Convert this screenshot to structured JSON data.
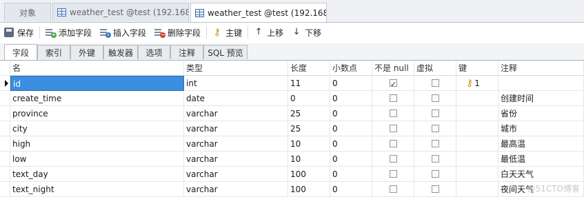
{
  "tabs": {
    "objects": "对象",
    "tab1": "weather_test @test (192.168...",
    "tab2": "weather_test @test (192.168..."
  },
  "toolbar": {
    "save": "保存",
    "add_field": "添加字段",
    "insert_field": "插入字段",
    "delete_field": "删除字段",
    "primary_key": "主键",
    "move_up": "上移",
    "move_down": "下移"
  },
  "subtabs": [
    "字段",
    "索引",
    "外键",
    "触发器",
    "选项",
    "注释",
    "SQL 预览"
  ],
  "columns": {
    "name": "名",
    "type": "类型",
    "length": "长度",
    "decimals": "小数点",
    "not_null": "不是 null",
    "virtual": "虚拟",
    "key": "键",
    "comment": "注释"
  },
  "rows": [
    {
      "name": "id",
      "type": "int",
      "length": "11",
      "decimals": "0",
      "not_null": true,
      "virtual": false,
      "key": "1",
      "comment": ""
    },
    {
      "name": "create_time",
      "type": "date",
      "length": "0",
      "decimals": "0",
      "not_null": false,
      "virtual": false,
      "key": "",
      "comment": "创建时间"
    },
    {
      "name": "province",
      "type": "varchar",
      "length": "25",
      "decimals": "0",
      "not_null": false,
      "virtual": false,
      "key": "",
      "comment": "省份"
    },
    {
      "name": "city",
      "type": "varchar",
      "length": "25",
      "decimals": "0",
      "not_null": false,
      "virtual": false,
      "key": "",
      "comment": "城市"
    },
    {
      "name": "high",
      "type": "varchar",
      "length": "10",
      "decimals": "0",
      "not_null": false,
      "virtual": false,
      "key": "",
      "comment": "最高温"
    },
    {
      "name": "low",
      "type": "varchar",
      "length": "10",
      "decimals": "0",
      "not_null": false,
      "virtual": false,
      "key": "",
      "comment": "最低温"
    },
    {
      "name": "text_day",
      "type": "varchar",
      "length": "100",
      "decimals": "0",
      "not_null": false,
      "virtual": false,
      "key": "",
      "comment": "白天天气"
    },
    {
      "name": "text_night",
      "type": "varchar",
      "length": "100",
      "decimals": "0",
      "not_null": false,
      "virtual": false,
      "key": "",
      "comment": "夜间天气"
    }
  ],
  "watermark": "@51CTO博客",
  "colors": {
    "selection": "#3b8ee0",
    "key_icon": "#c8960e"
  }
}
